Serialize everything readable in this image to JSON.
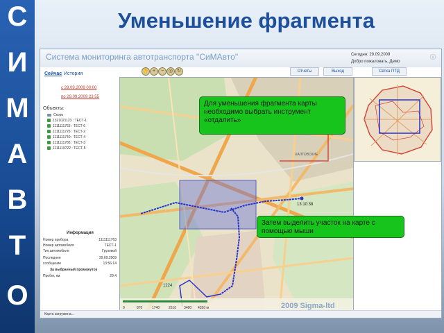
{
  "slide": {
    "title": "Уменьшение фрагмента",
    "vertical_letters": [
      "С",
      "И",
      "М",
      "А",
      "В",
      "Т",
      "О"
    ]
  },
  "app": {
    "title": "Система мониторинга автотранспорта \"СиМАвто\"",
    "date_line": "Сегодня: 29.09.2009",
    "welcome_line": "Добро пожаловать, Демо",
    "tabs": [
      "Сейчас",
      "История"
    ],
    "period_from": "с 28.09.2009 00:00",
    "period_to": "по 29.09.2009 23:55",
    "nav_buttons": [
      "Отчеты",
      "Выход"
    ],
    "minimap_button": "Сетка ПТД"
  },
  "objects": {
    "label": "Объекты:",
    "items": [
      {
        "label": "Скоро",
        "type": "group"
      },
      {
        "label": "1321021123 : ТЕСТ-1",
        "type": "vehicle"
      },
      {
        "label": "1111111763 : ТЕСТ-6",
        "type": "vehicle"
      },
      {
        "label": "1111111726 : ТЕСТ-2",
        "type": "vehicle"
      },
      {
        "label": "1111111740 : ТЕСТ-4",
        "type": "vehicle"
      },
      {
        "label": "1111111783 : ТЕСТ-3",
        "type": "vehicle"
      },
      {
        "label": "1111119722 : ТЕСТ-5",
        "type": "vehicle"
      }
    ]
  },
  "info": {
    "title": "Информация",
    "rows": [
      {
        "key": "Номер прибора",
        "value": "1111111763"
      },
      {
        "key": "Номер автомобиля",
        "value": "ТЕСТ-1"
      },
      {
        "key": "Тип автомобиля",
        "value": "Грузовой"
      },
      {
        "key": "Последнее",
        "value": "29.09.2009"
      },
      {
        "key": "сообщение",
        "value": "13:56:14"
      }
    ],
    "period_title": "За выбранный промежуток",
    "mileage_key": "Пробег, км",
    "mileage_value": "29.4"
  },
  "map": {
    "place_labels": [
      "ХАЛТОВСКИЕ",
      "1224"
    ],
    "time_label": "13:10:38",
    "scale_ticks": [
      "0",
      "870",
      "1740",
      "2610",
      "3480",
      "4350 м"
    ],
    "watermark": "2009 Sigma-ltd",
    "route_color": "#2733c8",
    "selection_color": "#6a74d8"
  },
  "callouts": {
    "zoom_out": "Для уменьшения фрагмента карты необходимо выбрать инструмент «отдалить»",
    "select_area": "Затем выделить участок на карте с помощью мыши"
  },
  "status": {
    "text": "Карта загружена..."
  }
}
